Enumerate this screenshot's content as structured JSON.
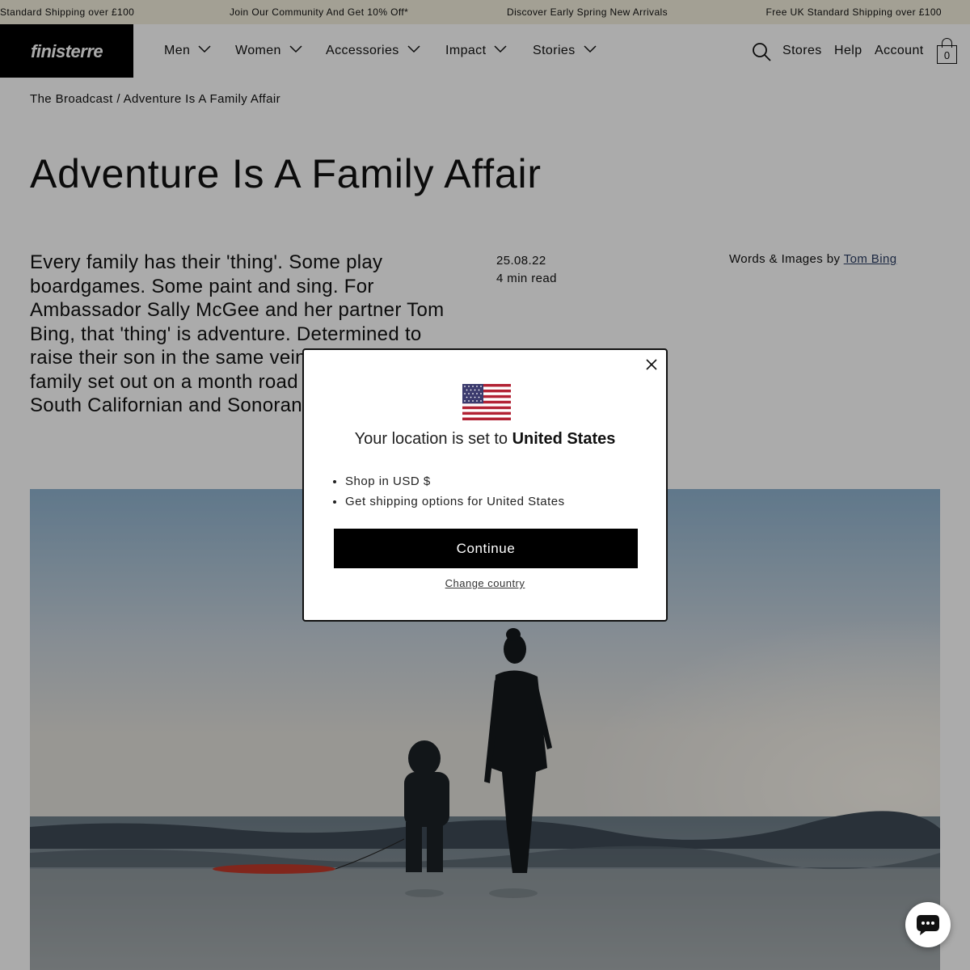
{
  "announcement_bar": {
    "messages": [
      "Standard Shipping over £100",
      "Join Our Community And Get 10% Off*",
      "Discover Early Spring New Arrivals",
      "Free UK Standard Shipping over £100"
    ]
  },
  "header": {
    "logo": "finisterre",
    "nav": [
      "Men",
      "Women",
      "Accessories",
      "Impact",
      "Stories"
    ],
    "icons": {
      "search": "search-icon",
      "cart": "cart-icon",
      "nav_chevron": "chevron-down-icon"
    },
    "links": {
      "stores": "Stores",
      "help": "Help",
      "account": "Account"
    },
    "cart_count": "0"
  },
  "article": {
    "breadcrumb": "The Broadcast / Adventure Is A Family Affair",
    "title": "Adventure Is A Family Affair",
    "intro": "Every family has their 'thing'. Some play boardgames. Some paint and sing. For Ambassador Sally McGee and her partner Tom Bing, that 'thing' is adventure. Determined to raise their son in the same vein, the young family set out on a month road trip through the South Californian and Sonoran deserts.",
    "date": "25.08.22",
    "read_time": "4 min read",
    "credit_prefix": "Words & Images by",
    "credit_name": "Tom Bing",
    "hero_image": "photo-beach-mother-child-wetsuits"
  },
  "modal": {
    "flag": "us-flag-icon",
    "location_prefix": "Your location is set to",
    "location_country": "United States",
    "bullets": [
      "Shop in USD $",
      "Get shipping options for United States"
    ],
    "continue_label": "Continue",
    "change_label": "Change country",
    "close_icon": "close-icon"
  },
  "chat": {
    "icon": "chat-bubble-icon"
  },
  "colors": {
    "announcement_bg": "#f3efdd",
    "logo_bg": "#000000",
    "link_blue": "#2a3d63",
    "button_bg": "#000000",
    "overlay": "rgba(0,0,0,0.33)"
  }
}
